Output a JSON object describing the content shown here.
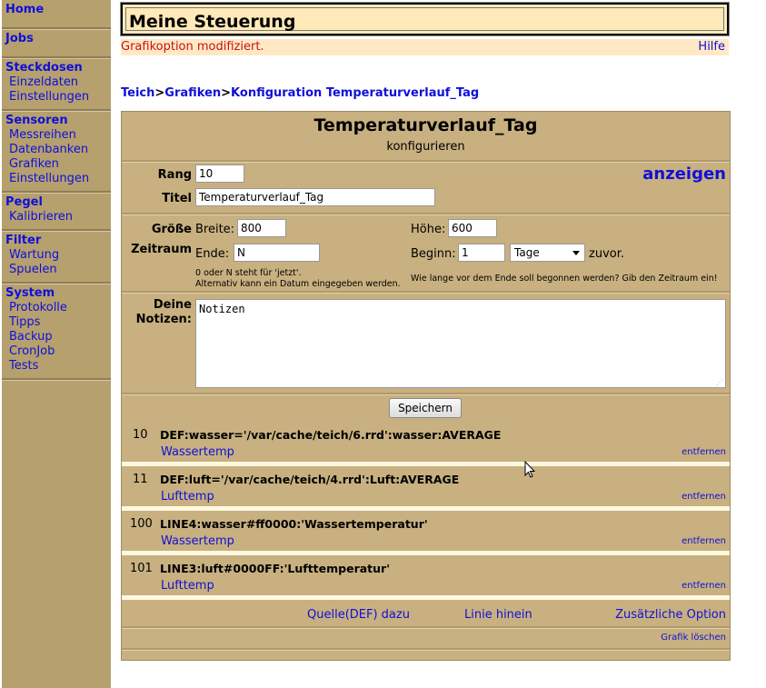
{
  "sidebar": {
    "home": "Home",
    "jobs": "Jobs",
    "steckdosen": {
      "head": "Steckdosen",
      "items": [
        "Einzeldaten",
        "Einstellungen"
      ]
    },
    "sensoren": {
      "head": "Sensoren",
      "items": [
        "Messreihen",
        "Datenbanken",
        "Grafiken",
        "Einstellungen"
      ]
    },
    "pegel": {
      "head": "Pegel",
      "items": [
        "Kalibrieren"
      ]
    },
    "filter": {
      "head": "Filter",
      "items": [
        "Wartung",
        "Spuelen"
      ]
    },
    "system": {
      "head": "System",
      "items": [
        "Protokolle",
        "Tipps",
        "Backup",
        "CronJob",
        "Tests"
      ]
    }
  },
  "header": {
    "title": "Meine Steuerung"
  },
  "status": {
    "message": "Grafikoption modifiziert.",
    "help": "Hilfe"
  },
  "breadcrumb": {
    "items": [
      "Teich",
      "Grafiken",
      "Konfiguration Temperaturverlauf_Tag"
    ],
    "separator": ">"
  },
  "panel": {
    "title": "Temperaturverlauf_Tag",
    "subtitle": "konfigurieren",
    "rang_label": "Rang",
    "rang_value": "10",
    "titel_label": "Titel",
    "titel_value": "Temperaturverlauf_Tag",
    "anzeigen": "anzeigen",
    "groesse_label": "Größe",
    "zeitraum_label": "Zeitraum",
    "breite_label": "Breite:",
    "breite_value": "800",
    "hoehe_label": "Höhe:",
    "hoehe_value": "600",
    "ende_label": "Ende:",
    "ende_value": "N",
    "beginn_label": "Beginn:",
    "beginn_value": "1",
    "unit_selected": "Tage",
    "zuvor": "zuvor.",
    "ende_hint_1": "0 oder N steht für 'jetzt'.",
    "ende_hint_2": "Alternativ kann ein Datum eingegeben werden.",
    "beginn_hint": "Wie lange vor dem Ende soll begonnen werden? Gib den Zeitraum ein!",
    "notizen_label_1": "Deine",
    "notizen_label_2": "Notizen:",
    "notizen_value": "Notizen",
    "save": "Speichern",
    "entries": [
      {
        "rank": "10",
        "def": "DEF:wasser='/var/cache/teich/6.rrd':wasser:AVERAGE",
        "link": "Wassertemp",
        "remove": "entfernen"
      },
      {
        "rank": "11",
        "def": "DEF:luft='/var/cache/teich/4.rrd':Luft:AVERAGE",
        "link": "Lufttemp",
        "remove": "entfernen"
      },
      {
        "rank": "100",
        "def": "LINE4:wasser#ff0000:'Wassertemperatur'",
        "link": "Wassertemp",
        "remove": "entfernen"
      },
      {
        "rank": "101",
        "def": "LINE3:luft#0000FF:'Lufttemperatur'",
        "link": "Lufttemp",
        "remove": "entfernen"
      }
    ],
    "add_source": "Quelle(DEF) dazu",
    "add_line": "Linie hinein",
    "add_option": "Zusätzliche Option",
    "delete_graphic": "Grafik löschen"
  },
  "colors": {
    "sidebar_bg": "#b5a06e",
    "panel_bg": "#c8b080",
    "header_bg": "#ffe9b8",
    "link": "#1010d8",
    "status": "#cc1010"
  }
}
